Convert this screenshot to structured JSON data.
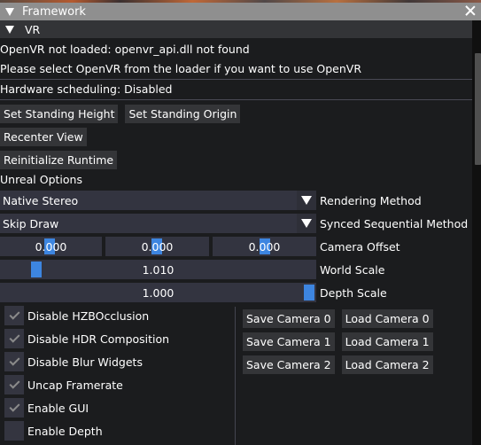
{
  "window": {
    "title": "Framework",
    "close_icon": "close-icon"
  },
  "vr_section": {
    "header": "VR",
    "status_lines": [
      "OpenVR not loaded: openvr_api.dll not found",
      "Please select OpenVR from the loader if you want to use OpenVR"
    ],
    "hardware_scheduling": "Hardware scheduling: Disabled",
    "buttons": {
      "set_standing_height": "Set Standing Height",
      "set_standing_origin": "Set Standing Origin",
      "recenter_view": "Recenter View",
      "reinitialize_runtime": "Reinitialize Runtime"
    },
    "unreal_options_label": "Unreal Options",
    "rendering_method": {
      "value": "Native Stereo",
      "label": "Rendering Method"
    },
    "synced_sequential_method": {
      "value": "Skip Draw",
      "label": "Synced Sequential Method"
    },
    "camera_offset": {
      "values": [
        "0.000",
        "0.000",
        "0.000"
      ],
      "label": "Camera Offset"
    },
    "world_scale": {
      "value": "1.010",
      "label": "World Scale",
      "slider_fraction": 0.1
    },
    "depth_scale": {
      "value": "1.000",
      "label": "Depth Scale",
      "slider_fraction": 1.0
    },
    "checkboxes": [
      {
        "label": "Disable HZBOcclusion",
        "checked": true
      },
      {
        "label": "Disable HDR Composition",
        "checked": true
      },
      {
        "label": "Disable Blur Widgets",
        "checked": true
      },
      {
        "label": "Uncap Framerate",
        "checked": true
      },
      {
        "label": "Enable GUI",
        "checked": true
      },
      {
        "label": "Enable Depth",
        "checked": false
      }
    ],
    "camera_buttons": [
      {
        "save": "Save Camera 0",
        "load": "Load Camera 0"
      },
      {
        "save": "Save Camera 1",
        "load": "Load Camera 1"
      },
      {
        "save": "Save Camera 2",
        "load": "Load Camera 2"
      }
    ]
  },
  "colors": {
    "accent": "#3d85e0",
    "title_bar": "#8f8f8f",
    "background": "#1b1c1e",
    "frame": "#333440"
  }
}
